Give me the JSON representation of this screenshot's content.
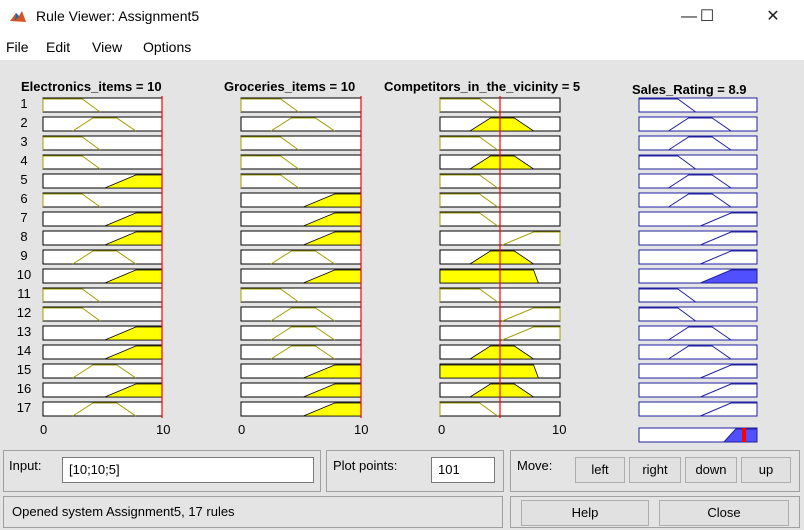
{
  "window": {
    "title": "Rule Viewer: Assignment5",
    "minimize_symbol": "—",
    "maximize_symbol": "☐",
    "close_symbol": "✕",
    "app_icon": "matlab-logo-icon"
  },
  "menu": [
    "File",
    "Edit",
    "View",
    "Options"
  ],
  "variables": [
    {
      "title": "Electronics_items = 10",
      "axis_min": "0",
      "axis_max": "10",
      "input_value": 10
    },
    {
      "title": "Groceries_items = 10",
      "axis_min": "0",
      "axis_max": "10",
      "input_value": 10
    },
    {
      "title": "Competitors_in_the_vicinity = 5",
      "axis_min": "0",
      "axis_max": "10",
      "input_value": 5
    }
  ],
  "output": {
    "title": "Sales_Rating = 8.9",
    "value": 8.9
  },
  "rule_numbers": [
    "1",
    "2",
    "3",
    "4",
    "5",
    "6",
    "7",
    "8",
    "9",
    "10",
    "11",
    "12",
    "13",
    "14",
    "15",
    "16",
    "17"
  ],
  "rules": [
    {
      "inputs": [
        "L",
        "L",
        "L"
      ],
      "output": "L"
    },
    {
      "inputs": [
        "M",
        "M",
        "M"
      ],
      "output": "M"
    },
    {
      "inputs": [
        "L",
        "L",
        "L"
      ],
      "output": "M"
    },
    {
      "inputs": [
        "L",
        "L",
        "M"
      ],
      "output": "L"
    },
    {
      "inputs": [
        "H",
        "L",
        "L"
      ],
      "output": "M"
    },
    {
      "inputs": [
        "L",
        "H",
        "L"
      ],
      "output": "M"
    },
    {
      "inputs": [
        "H",
        "H",
        "L"
      ],
      "output": "H"
    },
    {
      "inputs": [
        "H",
        "H",
        "H"
      ],
      "output": "H"
    },
    {
      "inputs": [
        "M",
        "M",
        "M"
      ],
      "output": "H"
    },
    {
      "inputs": [
        "H",
        "H",
        "H*"
      ],
      "output": "H"
    },
    {
      "inputs": [
        "L",
        "L",
        "L"
      ],
      "output": "L"
    },
    {
      "inputs": [
        "L",
        "M",
        "H"
      ],
      "output": "L"
    },
    {
      "inputs": [
        "H",
        "M",
        "H"
      ],
      "output": "M"
    },
    {
      "inputs": [
        "H",
        "M",
        "M"
      ],
      "output": "M"
    },
    {
      "inputs": [
        "M",
        "H",
        "H*"
      ],
      "output": "H"
    },
    {
      "inputs": [
        "H",
        "H",
        "M"
      ],
      "output": "H"
    },
    {
      "inputs": [
        "M",
        "H",
        "L"
      ],
      "output": "H"
    }
  ],
  "input_panel": {
    "label": "Input:",
    "value": "[10;10;5]"
  },
  "plot_points": {
    "label": "Plot points:",
    "value": "101"
  },
  "move": {
    "label": "Move:",
    "buttons": [
      "left",
      "right",
      "down",
      "up"
    ]
  },
  "status": "Opened system Assignment5, 17 rules",
  "help_label": "Help",
  "close_label": "Close",
  "colors": {
    "input_fill": "#ffff00",
    "output_fill": "#5050ff",
    "marker": "#ff0000",
    "output_line": "#2020a0"
  }
}
